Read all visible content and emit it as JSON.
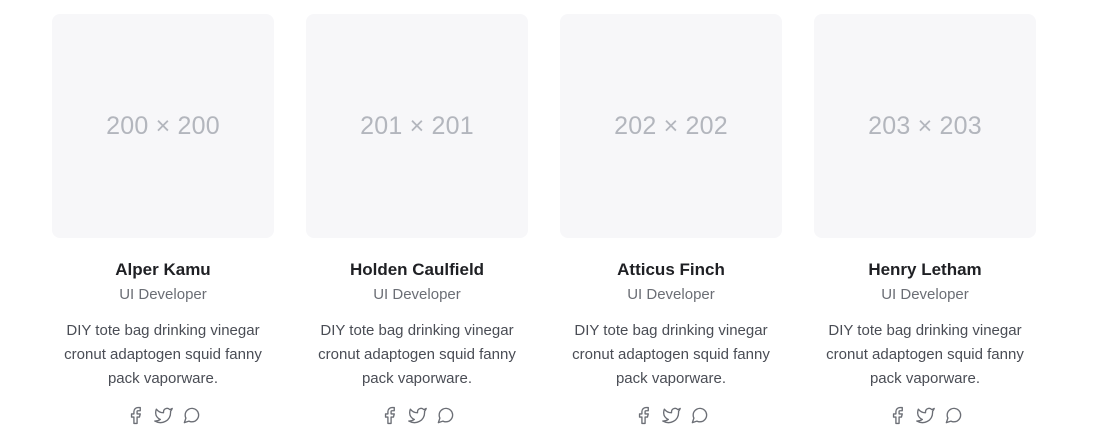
{
  "team": [
    {
      "avatar_label": "200 × 200",
      "name": "Alper Kamu",
      "role": "UI Developer",
      "bio": "DIY tote bag drinking vinegar cronut adaptogen squid fanny pack vaporware.",
      "socials": [
        "facebook-icon",
        "twitter-icon",
        "chat-icon"
      ]
    },
    {
      "avatar_label": "201 × 201",
      "name": "Holden Caulfield",
      "role": "UI Developer",
      "bio": "DIY tote bag drinking vinegar cronut adaptogen squid fanny pack vaporware.",
      "socials": [
        "facebook-icon",
        "twitter-icon",
        "chat-icon"
      ]
    },
    {
      "avatar_label": "202 × 202",
      "name": "Atticus Finch",
      "role": "UI Developer",
      "bio": "DIY tote bag drinking vinegar cronut adaptogen squid fanny pack vaporware.",
      "socials": [
        "facebook-icon",
        "twitter-icon",
        "chat-icon"
      ]
    },
    {
      "avatar_label": "203 × 203",
      "name": "Henry Letham",
      "role": "UI Developer",
      "bio": "DIY tote bag drinking vinegar cronut adaptogen squid fanny pack vaporware.",
      "socials": [
        "facebook-icon",
        "twitter-icon",
        "chat-icon"
      ]
    }
  ],
  "colors": {
    "avatar_bg": "#f7f7f9",
    "name": "#1f2024",
    "muted": "#6b6e75"
  }
}
